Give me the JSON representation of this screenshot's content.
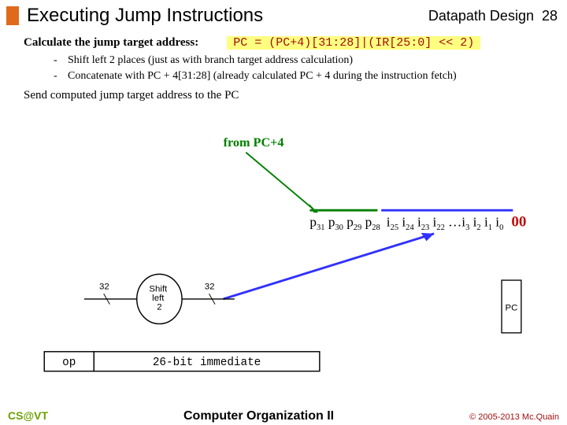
{
  "header": {
    "title": "Executing Jump Instructions",
    "section": "Datapath Design",
    "page": "28"
  },
  "calc": {
    "heading": "Calculate the jump target address:",
    "formula": "PC = (PC+4)[31:28]|(IR[25:0] << 2)",
    "bullets": [
      "Shift left 2 places (just as with branch target address calculation)",
      "Concatenate with PC + 4[31:28] (already calculated PC + 4 during the instruction fetch)"
    ],
    "send": "Send computed jump target address to the PC"
  },
  "diagram": {
    "from_pc4": "from PC+4",
    "p": [
      "p",
      "31",
      "p",
      "30",
      "p",
      "29",
      "p",
      "28"
    ],
    "i": [
      "i",
      "25",
      "i",
      "24",
      "i",
      "23",
      "i",
      "22",
      "…i",
      "3",
      "i",
      "2",
      "i",
      "1",
      "i",
      "0"
    ],
    "zeros": "00",
    "shift_label": "Shift\nleft\n2",
    "bus32a": "32",
    "bus32b": "32",
    "pc_box": "PC",
    "op": "op",
    "immediate": "26-bit immediate"
  },
  "footer": {
    "left": "CS@VT",
    "center": "Computer Organization II",
    "right": "© 2005-2013 Mc.Quain"
  }
}
